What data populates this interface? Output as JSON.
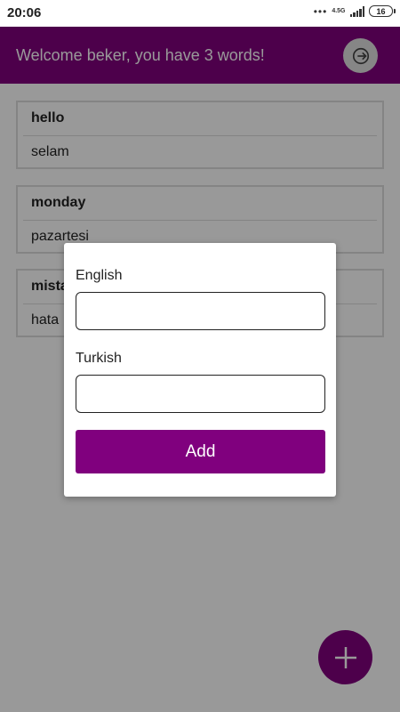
{
  "status_bar": {
    "time": "20:06",
    "network_label": "4.5G",
    "battery": "16"
  },
  "app_bar": {
    "title": "Welcome beker, you have 3 words!",
    "logout_icon": "logout-icon",
    "color": "#80007e"
  },
  "words": [
    {
      "english": "hello",
      "turkish": "selam"
    },
    {
      "english": "monday",
      "turkish": "pazartesi"
    },
    {
      "english": "mistake",
      "turkish": "hata"
    }
  ],
  "dialog": {
    "english_label": "English",
    "english_value": "",
    "turkish_label": "Turkish",
    "turkish_value": "",
    "add_label": "Add"
  },
  "fab": {
    "icon": "plus-icon"
  }
}
